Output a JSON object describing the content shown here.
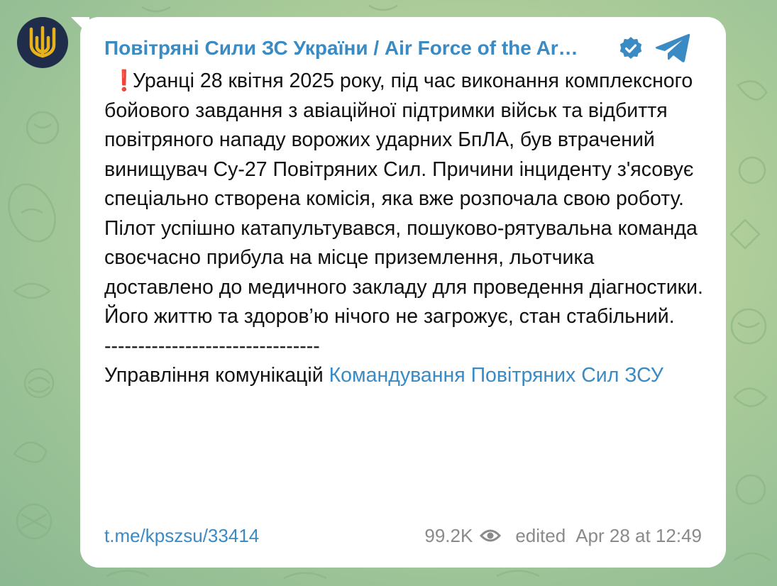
{
  "channel": {
    "name": "Повітряні Сили ЗС України / Air Force of the Ar…",
    "verified_icon": "verified-badge-icon",
    "app_icon": "telegram-icon",
    "avatar_icon": "trident-icon"
  },
  "message": {
    "alert_icon": "❗",
    "paragraph1": "Уранці 28 квітня 2025 року, під час виконання комплексного бойового завдання з авіаційної підтримки військ та відбиття повітряного нападу ворожих ударних БпЛА, був втрачений винищувач Су-27 Повітряних Сил. Причини інциденту з'ясовує спеціально створена комісія, яка вже розпочала свою роботу.",
    "paragraph2": "Пілот успішно катапультувався, пошуково-рятувальна команда своєчасно прибула на місце приземлення, льотчика доставлено до медичного закладу для проведення діагностики. Його життю та здоров’ю нічого не загрожує, стан стабільний.",
    "divider": "--------------------------------",
    "signature_prefix": "Управління комунікацій ",
    "signature_link": "Командування Повітряних Сил ЗСУ"
  },
  "footer": {
    "post_link": "t.me/kpszsu/33414",
    "views": "99.2K",
    "edited_label": "edited",
    "timestamp": "Apr 28 at 12:49"
  },
  "colors": {
    "link": "#3a8ac4",
    "meta": "#8a8a8a",
    "alert": "#e53935",
    "avatar_bg": "#1f2d4a",
    "avatar_trident": "#e8b21c"
  }
}
